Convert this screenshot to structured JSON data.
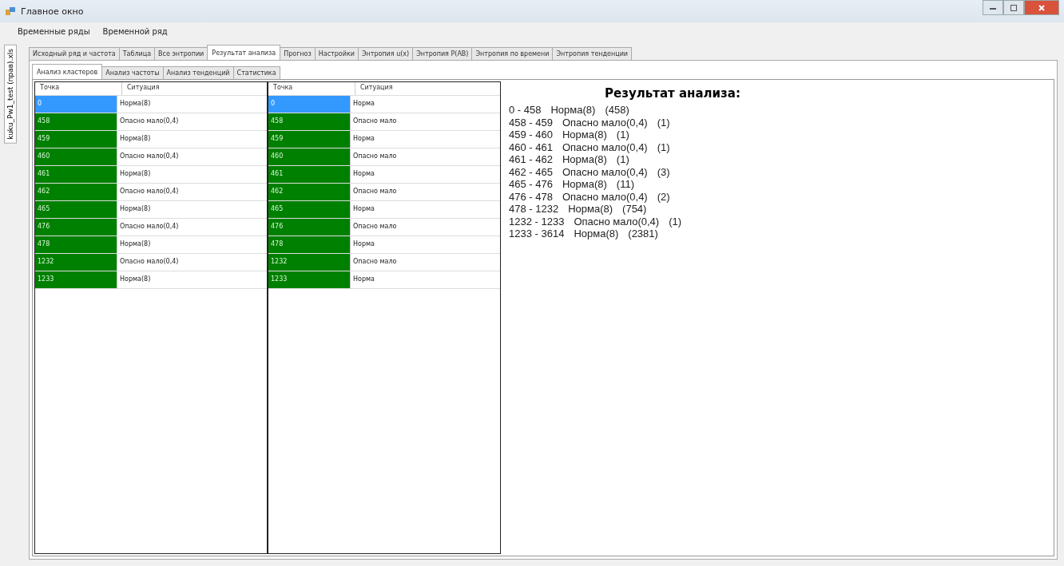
{
  "window": {
    "title": "Главное окно"
  },
  "menu": [
    "Временные ряды",
    "Временной ряд"
  ],
  "side_tab": "kuku_Pw1_test (прав).xls",
  "tabs": [
    {
      "label": "Исходный ряд и частота",
      "selected": false
    },
    {
      "label": "Таблица",
      "selected": false
    },
    {
      "label": "Все энтропии",
      "selected": false
    },
    {
      "label": "Результат анализа",
      "selected": true
    },
    {
      "label": "Прогноз",
      "selected": false
    },
    {
      "label": "Настройки",
      "selected": false
    },
    {
      "label": "Энтропия u(x)",
      "selected": false
    },
    {
      "label": "Энтропия P(AB)",
      "selected": false
    },
    {
      "label": "Энтропия по времени",
      "selected": false
    },
    {
      "label": "Энтропия тенденции",
      "selected": false
    }
  ],
  "subtabs": [
    {
      "label": "Анализ кластеров",
      "selected": true
    },
    {
      "label": "Анализ частоты",
      "selected": false
    },
    {
      "label": "Анализ тенденций",
      "selected": false
    },
    {
      "label": "Статистика",
      "selected": false
    }
  ],
  "grids": [
    {
      "columns": [
        "Точка",
        "Ситуация"
      ],
      "rows": [
        {
          "point": "0",
          "situation": "Норма(8)",
          "selected": true
        },
        {
          "point": "458",
          "situation": "Опасно мало(0,4)",
          "selected": false
        },
        {
          "point": "459",
          "situation": "Норма(8)",
          "selected": false
        },
        {
          "point": "460",
          "situation": "Опасно мало(0,4)",
          "selected": false
        },
        {
          "point": "461",
          "situation": "Норма(8)",
          "selected": false
        },
        {
          "point": "462",
          "situation": "Опасно мало(0,4)",
          "selected": false
        },
        {
          "point": "465",
          "situation": "Норма(8)",
          "selected": false
        },
        {
          "point": "476",
          "situation": "Опасно мало(0,4)",
          "selected": false
        },
        {
          "point": "478",
          "situation": "Норма(8)",
          "selected": false
        },
        {
          "point": "1232",
          "situation": "Опасно мало(0,4)",
          "selected": false
        },
        {
          "point": "1233",
          "situation": "Норма(8)",
          "selected": false
        }
      ]
    },
    {
      "columns": [
        "Точка",
        "Ситуация"
      ],
      "rows": [
        {
          "point": "0",
          "situation": "Норма",
          "selected": true
        },
        {
          "point": "458",
          "situation": "Опасно мало",
          "selected": false
        },
        {
          "point": "459",
          "situation": "Норма",
          "selected": false
        },
        {
          "point": "460",
          "situation": "Опасно мало",
          "selected": false
        },
        {
          "point": "461",
          "situation": "Норма",
          "selected": false
        },
        {
          "point": "462",
          "situation": "Опасно мало",
          "selected": false
        },
        {
          "point": "465",
          "situation": "Норма",
          "selected": false
        },
        {
          "point": "476",
          "situation": "Опасно мало",
          "selected": false
        },
        {
          "point": "478",
          "situation": "Норма",
          "selected": false
        },
        {
          "point": "1232",
          "situation": "Опасно мало",
          "selected": false
        },
        {
          "point": "1233",
          "situation": "Норма",
          "selected": false
        }
      ]
    }
  ],
  "result": {
    "title": "Результат анализа:",
    "lines": [
      {
        "range": "0 - 458",
        "situation": "Норма(8)",
        "count": "(458)"
      },
      {
        "range": "458 - 459",
        "situation": "Опасно мало(0,4)",
        "count": "(1)"
      },
      {
        "range": "459 - 460",
        "situation": "Норма(8)",
        "count": "(1)"
      },
      {
        "range": "460 - 461",
        "situation": "Опасно мало(0,4)",
        "count": "(1)"
      },
      {
        "range": "461 - 462",
        "situation": "Норма(8)",
        "count": "(1)"
      },
      {
        "range": "462 - 465",
        "situation": "Опасно мало(0,4)",
        "count": "(3)"
      },
      {
        "range": "465 - 476",
        "situation": "Норма(8)",
        "count": "(11)"
      },
      {
        "range": "476 - 478",
        "situation": "Опасно мало(0,4)",
        "count": "(2)"
      },
      {
        "range": "478 - 1232",
        "situation": "Норма(8)",
        "count": "(754)"
      },
      {
        "range": "1232 - 1233",
        "situation": "Опасно мало(0,4)",
        "count": "(1)"
      },
      {
        "range": "1233 - 3614",
        "situation": "Норма(8)",
        "count": "(2381)"
      }
    ]
  }
}
